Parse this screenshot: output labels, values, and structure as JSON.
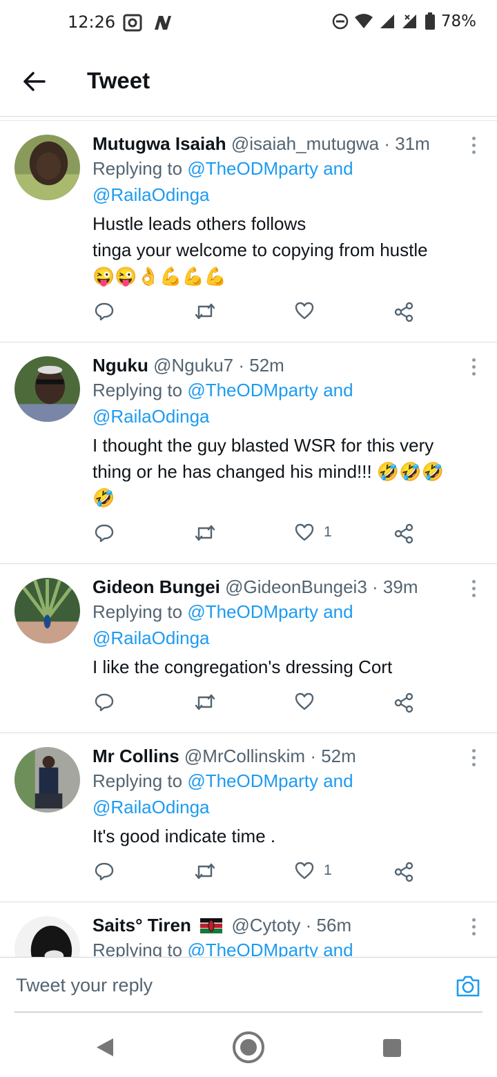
{
  "status_bar": {
    "time": "12:26",
    "battery": "78%",
    "left_icons": [
      "screenshot-icon",
      "n-icon"
    ],
    "right_icons": [
      "do-not-disturb-icon",
      "wifi-icon",
      "signal-icon",
      "signal-x-icon",
      "battery-icon"
    ]
  },
  "header": {
    "title": "Tweet",
    "back_icon": "arrow-left-icon"
  },
  "colors": {
    "accent": "#1d9bf0",
    "text": "#0f1419",
    "secondary": "#536471"
  },
  "tweets": [
    {
      "name": "Mutugwa Isaiah",
      "handle": "@isaiah_mutugwa",
      "time": "· 31m",
      "replying_prefix": "Replying to",
      "mention1": "@TheODMparty and",
      "mention2": "@RailaOdinga",
      "text_line1": "Hustle leads others follows",
      "text_line2": "tinga your welcome to copying from hustle",
      "emoji": "😜😜👌💪💪💪",
      "likes": "",
      "flag": ""
    },
    {
      "name": "Nguku",
      "handle": "@Nguku7",
      "time": "· 52m",
      "replying_prefix": "Replying to",
      "mention1": "@TheODMparty and",
      "mention2": "@RailaOdinga",
      "text_line1": "I thought the guy blasted WSR for this very",
      "text_line2": "thing or he has changed his mind!!! 🤣🤣🤣",
      "emoji": "🤣",
      "likes": "1",
      "flag": ""
    },
    {
      "name": "Gideon Bungei",
      "handle": "@GideonBungei3",
      "time": "· 39m",
      "replying_prefix": "Replying to",
      "mention1": "@TheODMparty and",
      "mention2": "@RailaOdinga",
      "text_line1": "I like the congregation's dressing Cort",
      "text_line2": "",
      "emoji": "",
      "likes": "",
      "flag": ""
    },
    {
      "name": "Mr Collins",
      "handle": "@MrCollinskim",
      "time": "· 52m",
      "replying_prefix": "Replying to",
      "mention1": "@TheODMparty and",
      "mention2": "@RailaOdinga",
      "text_line1": "It's good indicate time .",
      "text_line2": "",
      "emoji": "",
      "likes": "1",
      "flag": ""
    },
    {
      "name": "Saits° Tiren",
      "handle": "@Cytoty",
      "time": "· 56m",
      "replying_prefix": "Replying to",
      "mention1": "@TheODMparty and",
      "mention2": "",
      "text_line1": "",
      "text_line2": "",
      "emoji": "",
      "likes": "",
      "flag": "kenya-flag-icon"
    }
  ],
  "reply": {
    "placeholder": "Tweet your reply"
  },
  "nav": {
    "icons": [
      "back-triangle-icon",
      "home-circle-icon",
      "recents-square-icon"
    ]
  }
}
